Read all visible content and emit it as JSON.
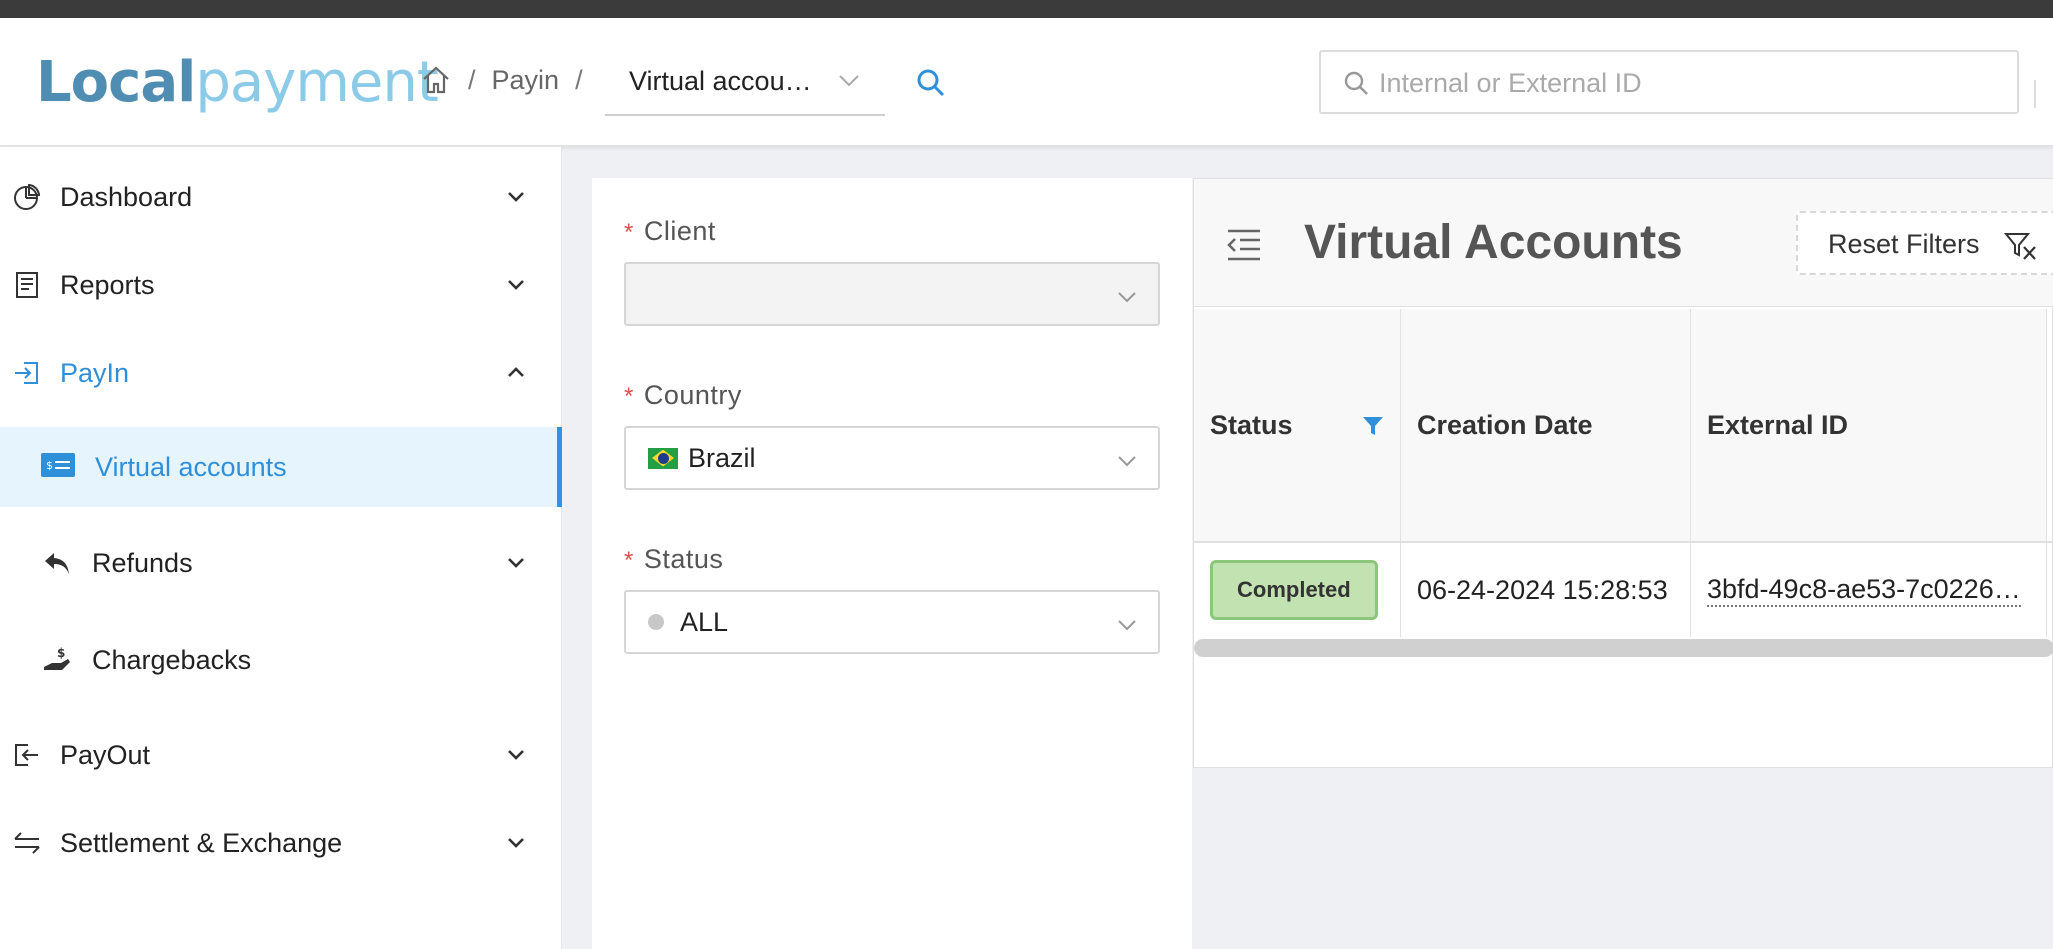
{
  "header": {
    "logo_part1": "Local",
    "logo_part2": "payment",
    "breadcrumb_payin": "Payin",
    "breadcrumb_sep": "/",
    "breadcrumb_select": "Virtual accou…",
    "search_placeholder": "Internal or External ID"
  },
  "sidebar": {
    "items": [
      {
        "label": "Dashboard",
        "icon": "pie-chart-icon"
      },
      {
        "label": "Reports",
        "icon": "report-icon"
      },
      {
        "label": "PayIn",
        "icon": "payin-icon"
      },
      {
        "label": "Virtual accounts",
        "icon": "virtual-account-icon"
      },
      {
        "label": "Refunds",
        "icon": "refund-icon"
      },
      {
        "label": "Chargebacks",
        "icon": "chargeback-icon"
      },
      {
        "label": "PayOut",
        "icon": "payout-icon"
      },
      {
        "label": "Settlement & Exchange",
        "icon": "exchange-icon"
      }
    ]
  },
  "filters": {
    "client_label": "Client",
    "client_value": "",
    "country_label": "Country",
    "country_value": "Brazil",
    "status_label": "Status",
    "status_value": "ALL",
    "required_mark": "*"
  },
  "panel": {
    "title": "Virtual Accounts",
    "reset_label": "Reset Filters",
    "columns": [
      "Status",
      "Creation Date",
      "External ID"
    ],
    "rows": [
      {
        "status": "Completed",
        "creation_date": "06-24-2024 15:28:53",
        "external_id": "3bfd-49c8-ae53-7c0226…"
      }
    ]
  },
  "colors": {
    "accent": "#2f8fd9",
    "badge_bg": "#c3e2b1",
    "required": "#e0504c"
  }
}
